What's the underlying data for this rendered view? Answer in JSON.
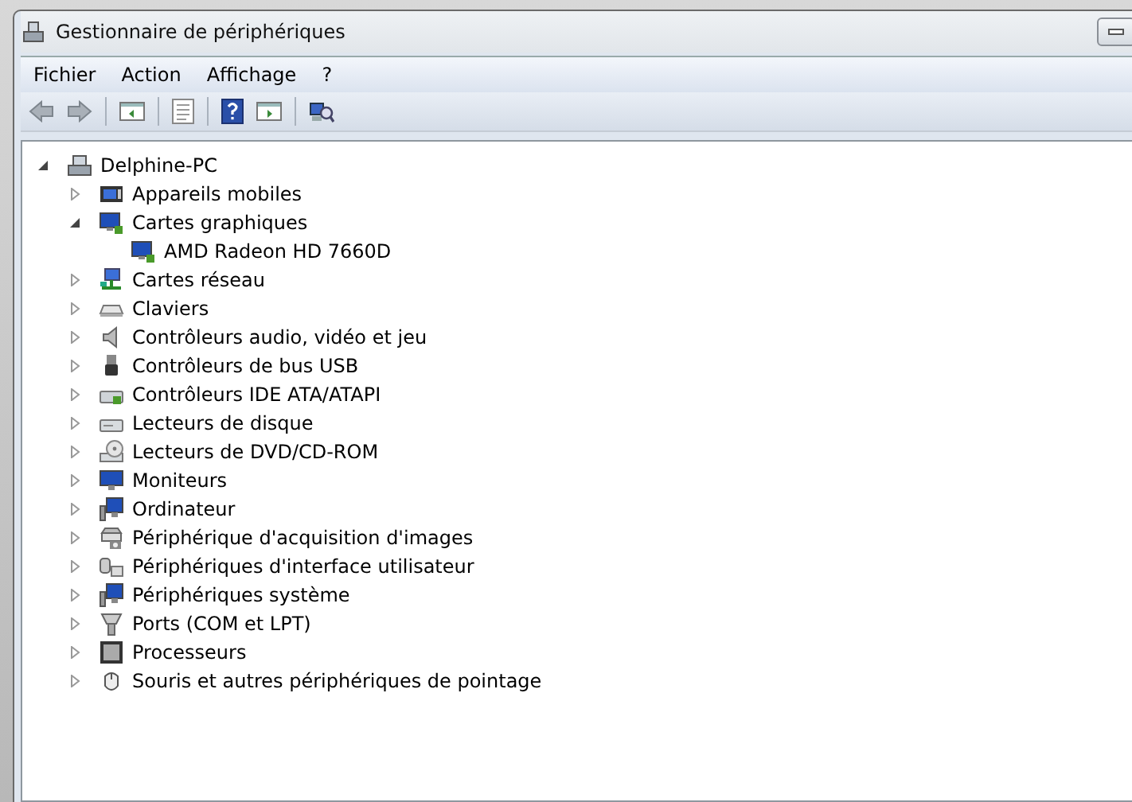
{
  "window": {
    "title": "Gestionnaire de périphériques"
  },
  "menu": [
    {
      "label": "Fichier"
    },
    {
      "label": "Action"
    },
    {
      "label": "Affichage"
    },
    {
      "label": "?"
    }
  ],
  "tree": {
    "label": "Delphine-PC",
    "expanded": true,
    "children": [
      {
        "label": "Appareils mobiles",
        "expanded": false
      },
      {
        "label": "Cartes graphiques",
        "expanded": true,
        "children": [
          {
            "label": "AMD Radeon HD 7660D"
          }
        ]
      },
      {
        "label": "Cartes réseau",
        "expanded": false
      },
      {
        "label": "Claviers",
        "expanded": false
      },
      {
        "label": "Contrôleurs audio, vidéo et jeu",
        "expanded": false
      },
      {
        "label": "Contrôleurs de bus USB",
        "expanded": false
      },
      {
        "label": "Contrôleurs IDE ATA/ATAPI",
        "expanded": false
      },
      {
        "label": "Lecteurs de disque",
        "expanded": false
      },
      {
        "label": "Lecteurs de DVD/CD-ROM",
        "expanded": false
      },
      {
        "label": "Moniteurs",
        "expanded": false
      },
      {
        "label": "Ordinateur",
        "expanded": false
      },
      {
        "label": "Périphérique d'acquisition d'images",
        "expanded": false
      },
      {
        "label": "Périphériques d'interface utilisateur",
        "expanded": false
      },
      {
        "label": "Périphériques système",
        "expanded": false
      },
      {
        "label": "Ports (COM et LPT)",
        "expanded": false
      },
      {
        "label": "Processeurs",
        "expanded": false
      },
      {
        "label": "Souris et autres périphériques de pointage",
        "expanded": false
      }
    ]
  }
}
